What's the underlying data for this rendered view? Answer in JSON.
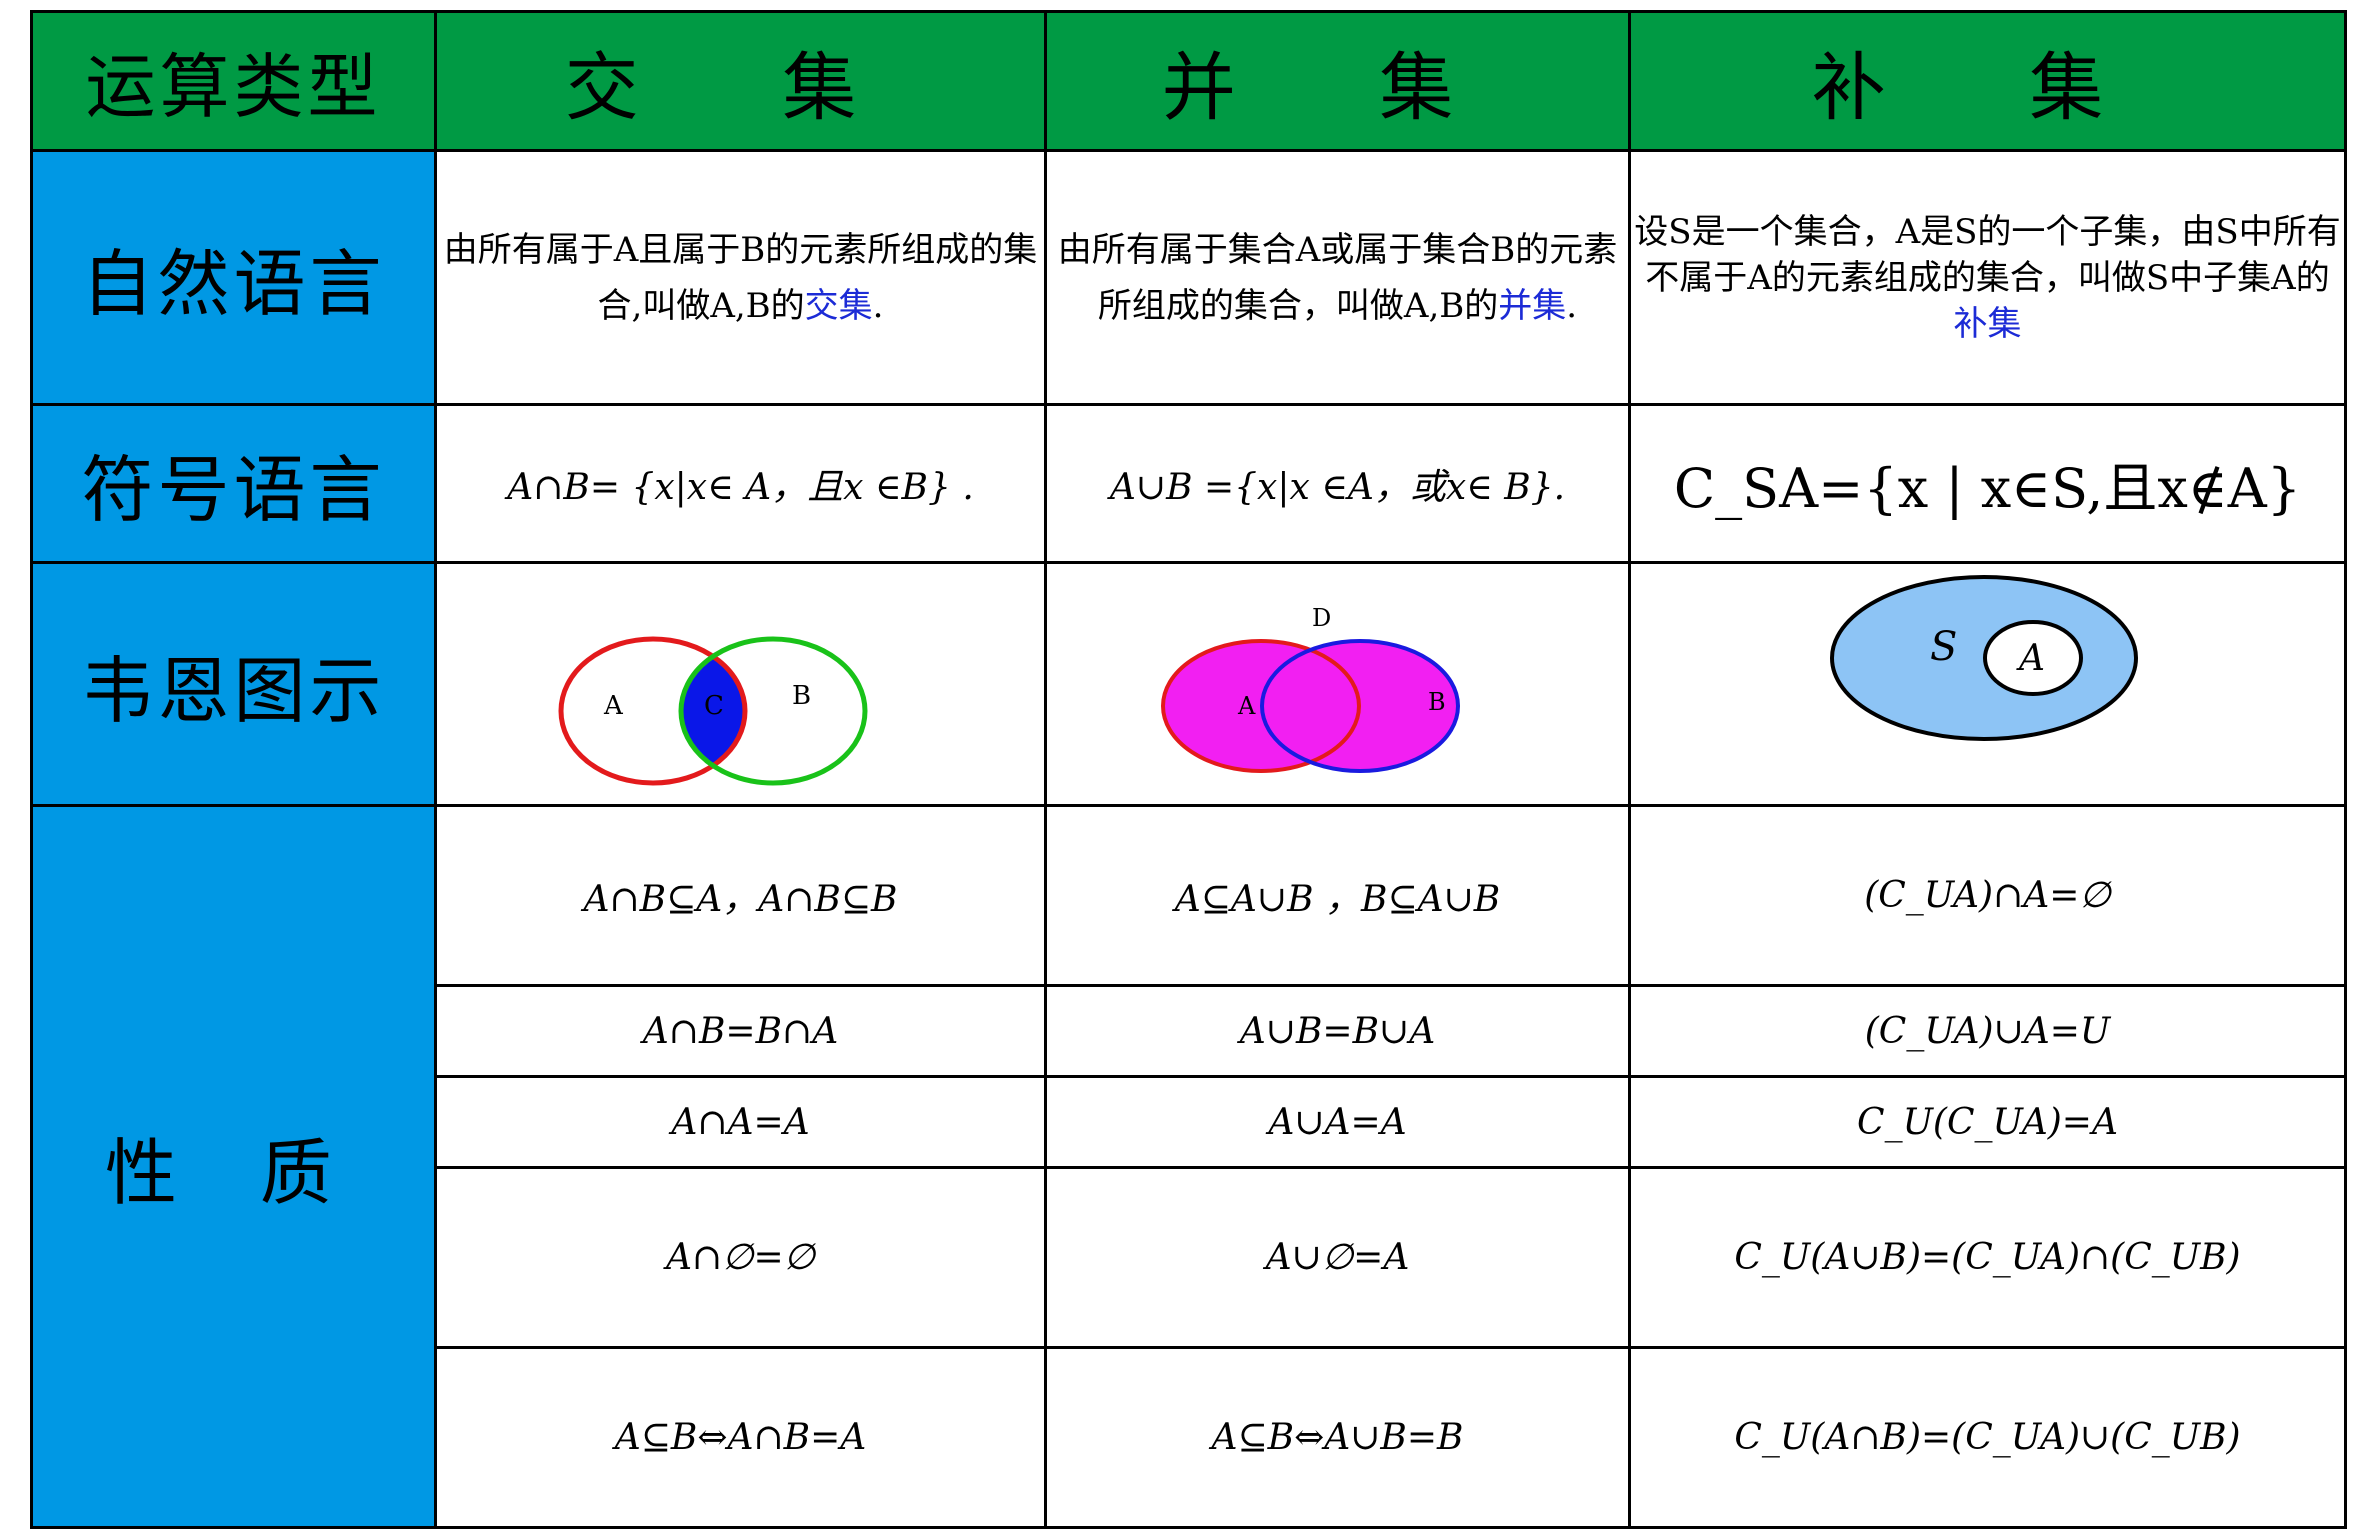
{
  "header": {
    "col0": "运算类型",
    "col1": "交 集",
    "col2": "并 集",
    "col3": "补 集"
  },
  "rows": {
    "natural_language": "自然语言",
    "symbol_language": "符号语言",
    "venn_diagram": "韦恩图示",
    "properties": "性 质"
  },
  "natural": {
    "intersection": {
      "pre": "由所有属于A且属于B的元素所组成的集合,叫做A,B的",
      "term": "交集",
      "post": "."
    },
    "union": {
      "pre": "由所有属于集合A或属于集合B的元素所组成的集合，叫做A,B的",
      "term": "并集",
      "post": "."
    },
    "complement": {
      "pre": "设S是一个集合，A是S的一个子集，由S中所有不属于A的元素组成的集合，叫做S中子集A的",
      "term": "补集",
      "post": ""
    }
  },
  "symbol": {
    "intersection": "A∩B= {x|x∈ A，且x ∈B} .",
    "union": "A∪B ={x|x ∈A，或x∈ B}.",
    "complement": "C_SA={x | x∈S,且x∉A}"
  },
  "venn": {
    "intersection": {
      "labels": [
        "A",
        "C",
        "B"
      ],
      "colors": {
        "a": "#e31a1c",
        "b": "#19c219",
        "overlap": "#0a17e8"
      }
    },
    "union": {
      "labels": [
        "A",
        "B",
        "D"
      ],
      "colors": {
        "fill": "#f21ff2",
        "a": "#e31a1c",
        "b": "#1a1ae0"
      }
    },
    "complement": {
      "labels": [
        "S",
        "A"
      ],
      "colors": {
        "fill": "#8dc4f5",
        "inner": "#ffffff"
      }
    }
  },
  "properties": {
    "intersection": [
      "A∩B⊆A，A∩B⊆B",
      "A∩B=B∩A",
      "A∩A=A",
      "A∩∅=∅",
      "A⊆B⇔A∩B=A"
    ],
    "union": [
      "A⊆A∪B ，B⊆A∪B",
      "A∪B=B∪A",
      "A∪A=A",
      "A∪∅=A",
      "A⊆B⇔A∪B=B"
    ],
    "complement": [
      "(C_UA)∩A=∅",
      "(C_UA)∪A=U",
      "C_U(C_UA)=A",
      "C_U(A∪B)=(C_UA)∩(C_UB)",
      "C_U(A∩B)=(C_UA)∪(C_UB)"
    ]
  }
}
